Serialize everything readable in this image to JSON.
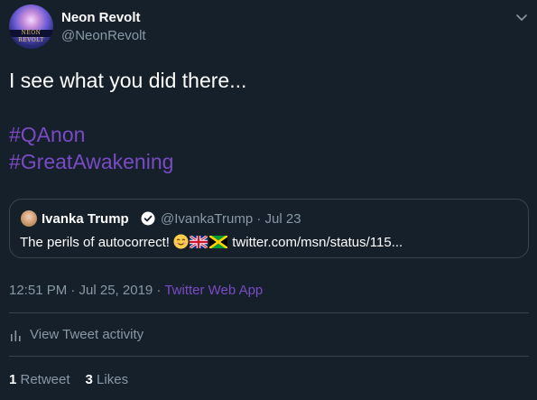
{
  "author": {
    "display_name": "Neon Revolt",
    "handle": "@NeonRevolt",
    "avatar_banner_text": "NEON REVOLT"
  },
  "tweet": {
    "text_line1": "I see what you did there...",
    "hashtags": [
      "#QAnon",
      "#GreatAwakening"
    ]
  },
  "quoted_tweet": {
    "display_name": "Ivanka Trump",
    "verified": true,
    "handle_date": "@IvankaTrump · Jul 23",
    "text_prefix": "The perils of autocorrect!",
    "emojis": [
      "smiling-face",
      "uk-flag",
      "jamaica-flag"
    ],
    "link_text": " twitter.com/msn/status/115..."
  },
  "meta": {
    "timestamp": "12:51 PM · Jul 25, 2019 · ",
    "source": "Twitter Web App"
  },
  "activity": {
    "label": "View Tweet activity"
  },
  "stats": {
    "retweet_count": "1",
    "retweet_label": " Retweet",
    "like_count": "3",
    "like_label": " Likes"
  },
  "colors": {
    "background": "#15202b",
    "hashtag": "#794bc4",
    "secondary_text": "#8899a6",
    "divider": "#38444d"
  }
}
